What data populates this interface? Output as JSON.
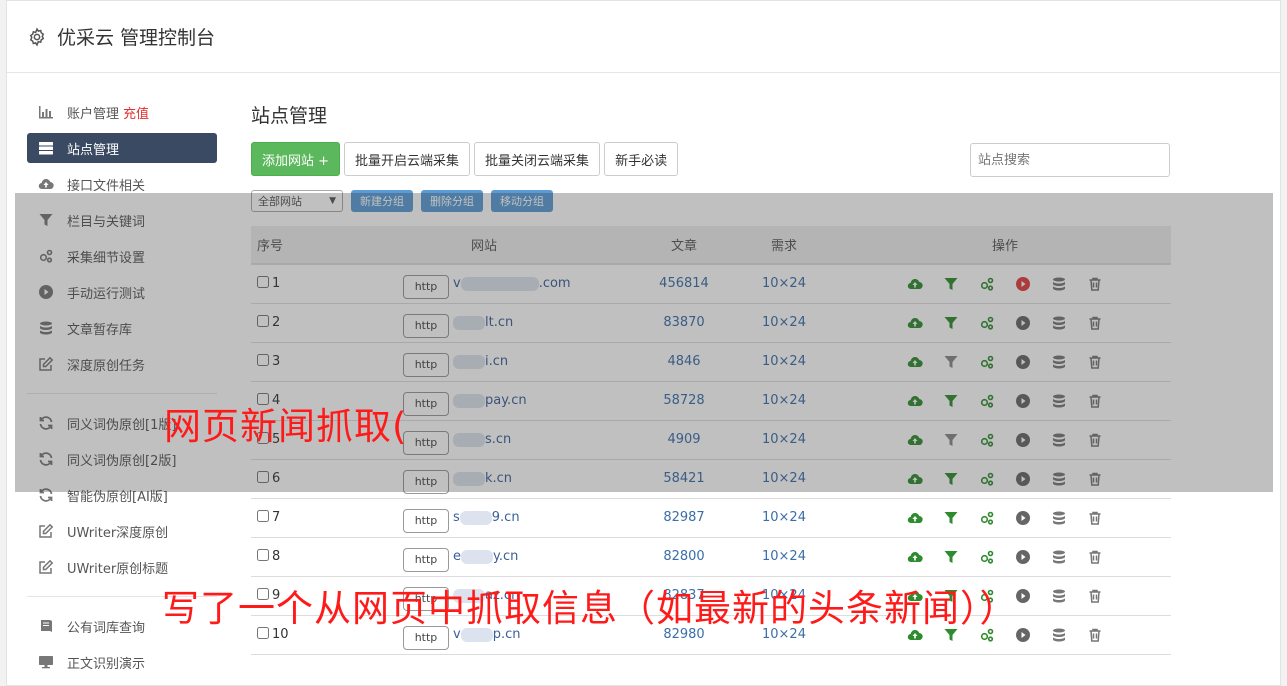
{
  "header": {
    "title": "优采云 管理控制台",
    "icon": "gear-icon"
  },
  "sidebar": {
    "group1": [
      {
        "label": "账户管理",
        "badge": "充值",
        "icon": "bar-chart-icon"
      },
      {
        "label": "站点管理",
        "icon": "server-icon",
        "active": true
      },
      {
        "label": "接口文件相关",
        "icon": "cloud-upload-icon"
      },
      {
        "label": "栏目与关键词",
        "icon": "filter-icon"
      },
      {
        "label": "采集细节设置",
        "icon": "cogs-icon"
      },
      {
        "label": "手动运行测试",
        "icon": "play-circle-icon"
      },
      {
        "label": "文章暂存库",
        "icon": "database-icon"
      },
      {
        "label": "深度原创任务",
        "icon": "edit-icon"
      }
    ],
    "group2": [
      {
        "label": "同义词伪原创[1版]",
        "icon": "refresh-icon"
      },
      {
        "label": "同义词伪原创[2版]",
        "icon": "refresh-icon"
      },
      {
        "label": "智能伪原创[AI版]",
        "icon": "refresh-icon"
      },
      {
        "label": "UWriter深度原创",
        "icon": "edit-icon"
      },
      {
        "label": "UWriter原创标题",
        "icon": "edit-icon"
      }
    ],
    "group3": [
      {
        "label": "公有词库查询",
        "icon": "book-icon"
      },
      {
        "label": "正文识别演示",
        "icon": "monitor-icon"
      }
    ]
  },
  "main": {
    "title": "站点管理",
    "toolbar": {
      "add_site": "添加网站 +",
      "batch_enable": "批量开启云端采集",
      "batch_disable": "批量关闭云端采集",
      "beginner": "新手必读"
    },
    "search_placeholder": "站点搜索",
    "group_select": "全部网站",
    "group_buttons": {
      "new": "新建分组",
      "delete": "删除分组",
      "move": "移动分组"
    },
    "columns": {
      "index": "序号",
      "site": "网站",
      "articles": "文章",
      "demand": "需求",
      "actions": "操作"
    },
    "rows": [
      {
        "index": "1",
        "prefix": "http",
        "domain_start": "v",
        "domain_end": ".com",
        "articles": "456814",
        "demand": "10×24",
        "playing": true,
        "filter_active": true
      },
      {
        "index": "2",
        "prefix": "http",
        "domain_start": "",
        "domain_end": "lt.cn",
        "articles": "83870",
        "demand": "10×24",
        "playing": false,
        "filter_active": true
      },
      {
        "index": "3",
        "prefix": "http",
        "domain_start": "",
        "domain_end": "i.cn",
        "articles": "4846",
        "demand": "10×24",
        "playing": false,
        "filter_active": false
      },
      {
        "index": "4",
        "prefix": "http",
        "domain_start": "",
        "domain_end": "pay.cn",
        "articles": "58728",
        "demand": "10×24",
        "playing": false,
        "filter_active": true
      },
      {
        "index": "5",
        "prefix": "http",
        "domain_start": "",
        "domain_end": "s.cn",
        "articles": "4909",
        "demand": "10×24",
        "playing": false,
        "filter_active": false
      },
      {
        "index": "6",
        "prefix": "http",
        "domain_start": "",
        "domain_end": "k.cn",
        "articles": "58421",
        "demand": "10×24",
        "playing": false,
        "filter_active": true
      },
      {
        "index": "7",
        "prefix": "http",
        "domain_start": "s",
        "domain_end": "9.cn",
        "articles": "82987",
        "demand": "10×24",
        "playing": false,
        "filter_active": true
      },
      {
        "index": "8",
        "prefix": "http",
        "domain_start": "e",
        "domain_end": "y.cn",
        "articles": "82800",
        "demand": "10×24",
        "playing": false,
        "filter_active": true
      },
      {
        "index": "9",
        "prefix": "http",
        "domain_start": "",
        "domain_end": "az.cn",
        "articles": "82837",
        "demand": "10×24",
        "playing": false,
        "filter_active": true
      },
      {
        "index": "10",
        "prefix": "http",
        "domain_start": "v",
        "domain_end": "p.cn",
        "articles": "82980",
        "demand": "10×24",
        "playing": false,
        "filter_active": true
      }
    ]
  },
  "watermarks": {
    "line1": "网页新闻抓取(",
    "line2": "写了一个从网页中抓取信息（如最新的头条新闻））"
  },
  "colors": {
    "active_sidebar": "#3b4a63",
    "primary_green": "#5cb85c",
    "group_button_blue": "#5b9bd5",
    "icon_green": "#2e8b2e",
    "play_red": "#e23b3b",
    "watermark_red": "#ff1a1a",
    "recharge_red": "#e52e2e"
  }
}
